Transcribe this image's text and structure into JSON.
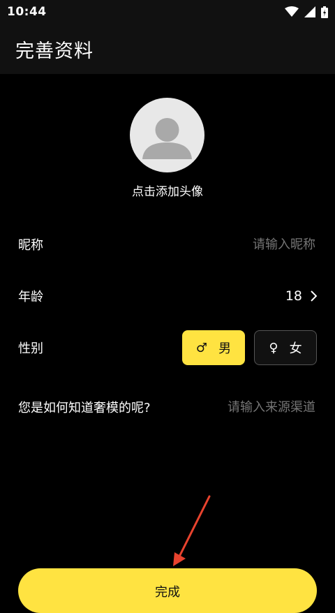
{
  "status_bar": {
    "time": "10:44",
    "icons": [
      "wifi-icon",
      "cellular-signal-icon",
      "battery-icon"
    ]
  },
  "app_bar": {
    "title": "完善资料"
  },
  "avatar": {
    "caption": "点击添加头像"
  },
  "form": {
    "nickname": {
      "label": "昵称",
      "placeholder": "请输入昵称"
    },
    "age": {
      "label": "年龄",
      "value": "18"
    },
    "gender": {
      "label": "性别",
      "options": [
        {
          "symbol": "♂",
          "label": "男",
          "selected": true
        },
        {
          "symbol": "♀",
          "label": "女",
          "selected": false
        }
      ]
    },
    "source": {
      "label": "您是如何知道奢模的呢?",
      "placeholder": "请输入来源渠道"
    }
  },
  "submit": {
    "label": "完成"
  },
  "colors": {
    "accent": "#ffe341",
    "background": "#000000",
    "bar_background": "#111111",
    "placeholder": "#8a8a8a",
    "annotation_arrow": "#e8432e"
  }
}
